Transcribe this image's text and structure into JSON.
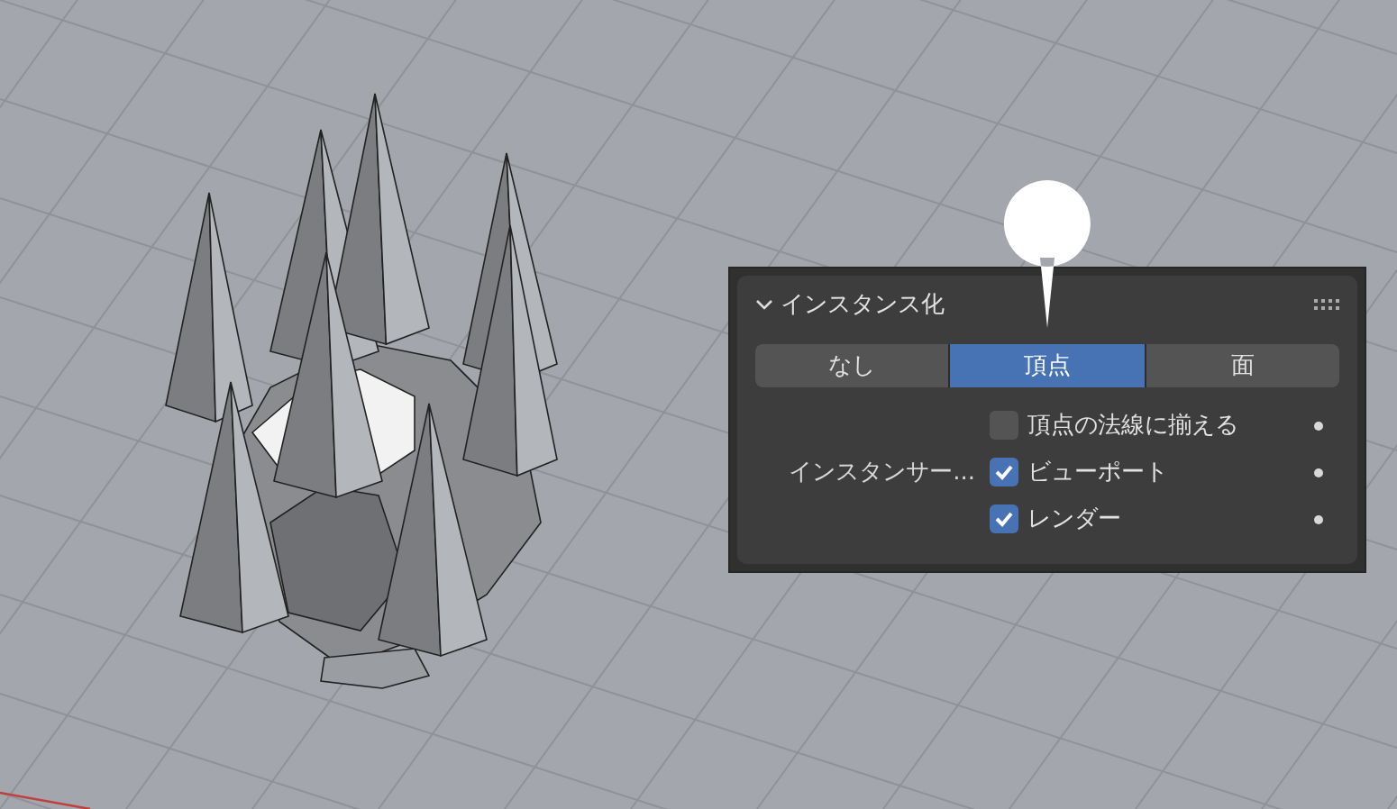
{
  "panel": {
    "title": "インスタンス化",
    "expanded": true,
    "modes": [
      {
        "label": "なし",
        "selected": false
      },
      {
        "label": "頂点",
        "selected": true
      },
      {
        "label": "面",
        "selected": false
      }
    ],
    "options": [
      {
        "label": "頂点の法線に揃える",
        "checked": false
      },
      {
        "group_label": "インスタンサー...",
        "label": "ビューポート",
        "checked": true
      },
      {
        "label": "レンダー",
        "checked": true
      }
    ]
  }
}
